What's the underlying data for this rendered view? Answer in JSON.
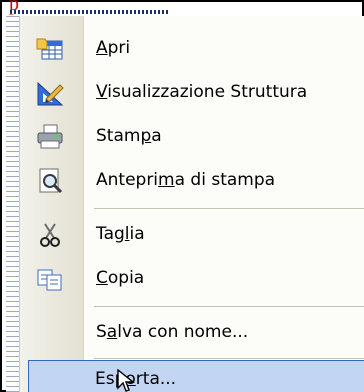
{
  "header": {
    "red_mark": "p"
  },
  "menu": {
    "items": [
      {
        "id": "apri",
        "pre": "",
        "u": "A",
        "post": "pri",
        "icon": "open-table-icon"
      },
      {
        "id": "visualizzazione-struttura",
        "pre": "",
        "u": "V",
        "post": "isualizzazione Struttura",
        "icon": "design-view-icon"
      },
      {
        "id": "stampa",
        "pre": "Stam",
        "u": "p",
        "post": "a",
        "icon": "printer-icon"
      },
      {
        "id": "anteprima-di-stampa",
        "pre": "Antepri",
        "u": "m",
        "post": "a di stampa",
        "icon": "print-preview-icon"
      },
      {
        "id": "taglia",
        "pre": "Tag",
        "u": "l",
        "post": "ia",
        "icon": "scissors-icon"
      },
      {
        "id": "copia",
        "pre": "",
        "u": "C",
        "post": "opia",
        "icon": "copy-icon"
      },
      {
        "id": "salva-con-nome",
        "pre": "S",
        "u": "a",
        "post": "lva con nome...",
        "icon": ""
      },
      {
        "id": "esporta",
        "pre": "Esp",
        "u": "o",
        "post": "rta...",
        "icon": "",
        "highlighted": true
      }
    ]
  },
  "colors": {
    "highlight_bg": "#c2d5f2",
    "highlight_border": "#316ac5",
    "gutter": "#e3e1d3",
    "red_mark": "#d40000"
  }
}
